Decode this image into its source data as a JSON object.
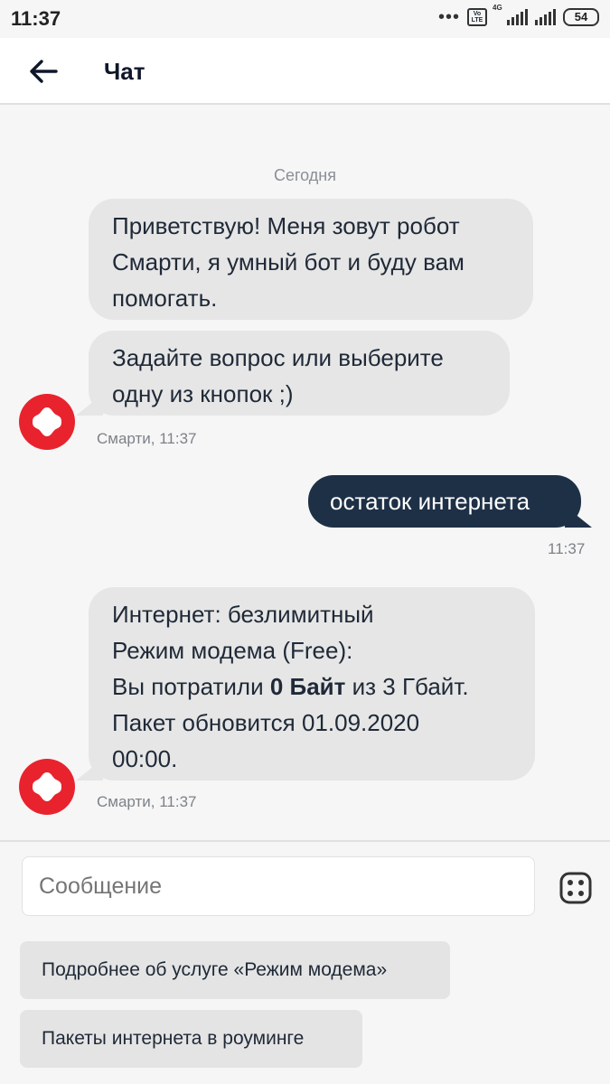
{
  "status_bar": {
    "time": "11:37",
    "dots": "•••",
    "volte": "Vo LTE",
    "network": "4G",
    "battery": "54"
  },
  "header": {
    "title": "Чат"
  },
  "chat": {
    "date_separator": "Сегодня",
    "messages": [
      {
        "sender": "bot",
        "text": "Приветствую! Меня зовут робот Смарти, я умный бот и буду вам помогать."
      },
      {
        "sender": "bot",
        "text": "Задайте вопрос или выберите одну из кнопок ;)",
        "meta": "Смарти, 11:37"
      },
      {
        "sender": "user",
        "text": "остаток интернета",
        "meta": "11:37"
      },
      {
        "sender": "bot",
        "lines": {
          "l1": "Интернет: безлимитный",
          "l2": "Режим модема (Free):",
          "l3_pre": "Вы потратили ",
          "l3_bold": "0 Байт",
          "l3_post": " из 3 Гбайт.",
          "l4": "Пакет обновится 01.09.2020",
          "l5": "00:00."
        },
        "meta": "Смарти, 11:37"
      }
    ]
  },
  "composer": {
    "placeholder": "Сообщение",
    "quick_replies": [
      "Подробнее об услуге «Режим модема»",
      "Пакеты интернета в роуминге"
    ]
  },
  "colors": {
    "accent_red": "#e8232e",
    "user_bubble": "#1e3046",
    "bot_bubble": "#e6e6e6"
  }
}
